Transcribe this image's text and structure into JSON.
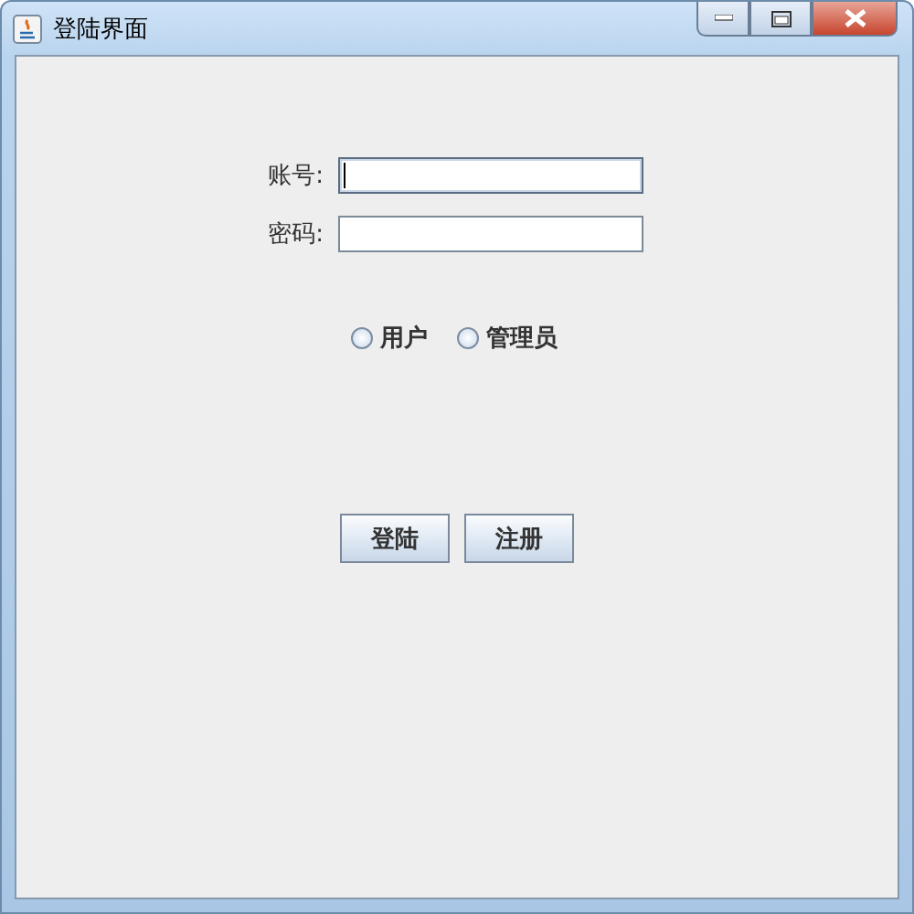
{
  "window": {
    "title": "登陆界面"
  },
  "fields": [
    {
      "label": "账号:",
      "focused": true
    },
    {
      "label": "密码:",
      "focused": false
    }
  ],
  "role_options": [
    {
      "label": "用户",
      "selected": false
    },
    {
      "label": "管理员",
      "selected": false
    }
  ],
  "buttons": [
    "登陆",
    "注册"
  ]
}
